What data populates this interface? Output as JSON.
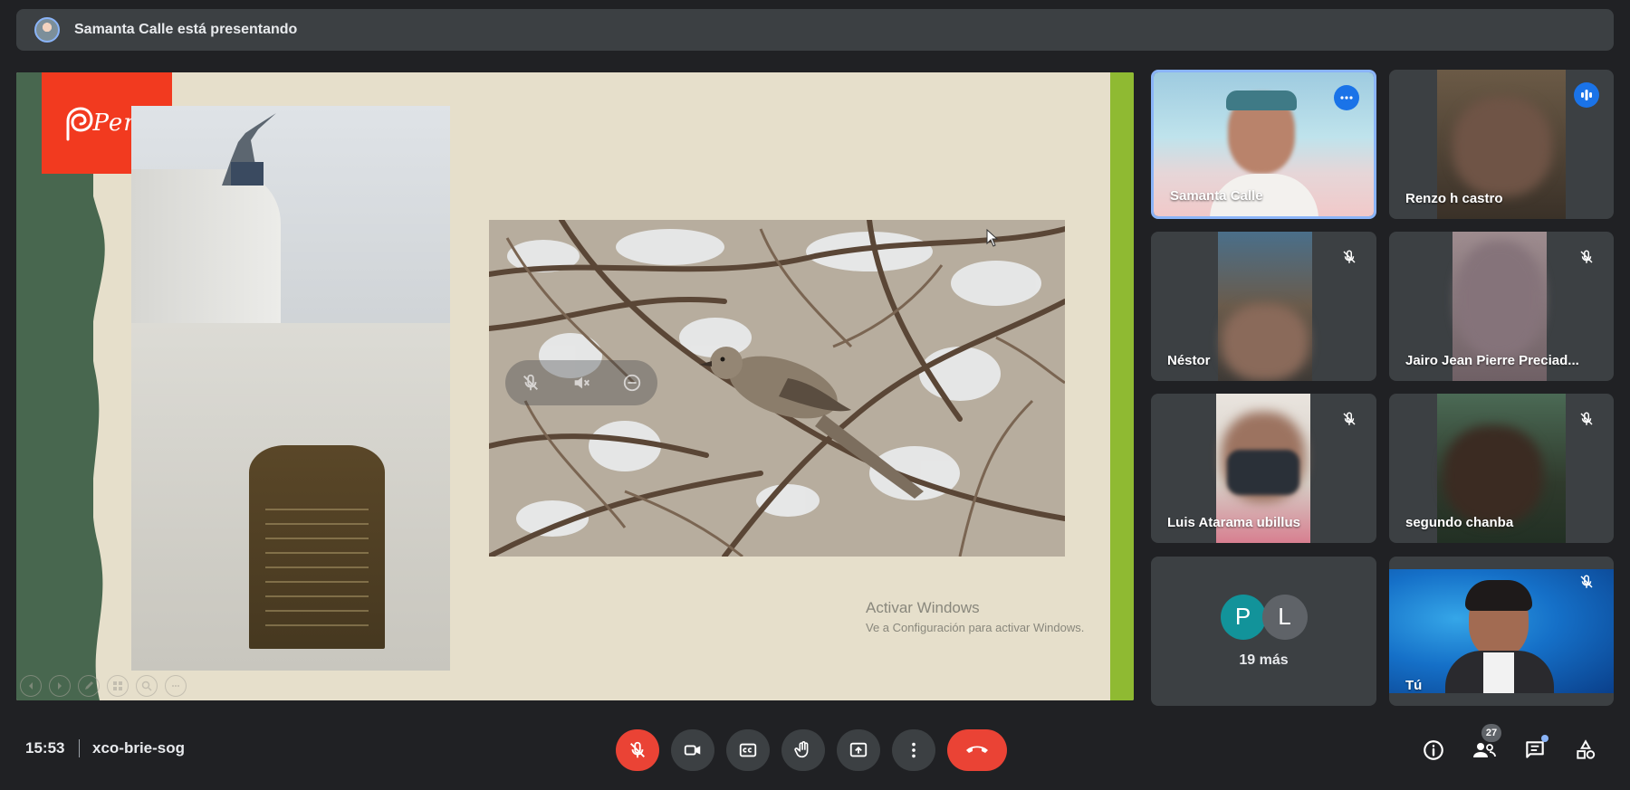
{
  "presenter_bar": {
    "text": "Samanta Calle está presentando"
  },
  "slide": {
    "logo_text": "Perú",
    "watermark_line1": "Activar Windows",
    "watermark_line2": "Ve a Configuración para activar Windows."
  },
  "tiles": [
    {
      "name": "Samanta Calle",
      "mic": "more-options"
    },
    {
      "name": "Renzo h        castro",
      "mic": "speaking"
    },
    {
      "name": "Néstor",
      "mic": "muted"
    },
    {
      "name": "Jairo Jean Pierre Preciad...",
      "mic": "muted"
    },
    {
      "name": "Luis Atarama ubillus",
      "mic": "muted"
    },
    {
      "name": "segundo chanba",
      "mic": "muted"
    },
    {
      "name": "Tú",
      "mic": "muted"
    }
  ],
  "more_people": {
    "avatars": [
      {
        "letter": "P",
        "color": "#12939a"
      },
      {
        "letter": "L",
        "color": "#5f6368"
      }
    ],
    "label": "19 más"
  },
  "bottom_bar": {
    "time": "15:53",
    "meeting_code": "xco-brie-sog",
    "participants_count": "27"
  },
  "colors": {
    "accent": "#8ab4f8",
    "danger": "#ea4335",
    "surface": "#3c4043",
    "background": "#202124"
  }
}
